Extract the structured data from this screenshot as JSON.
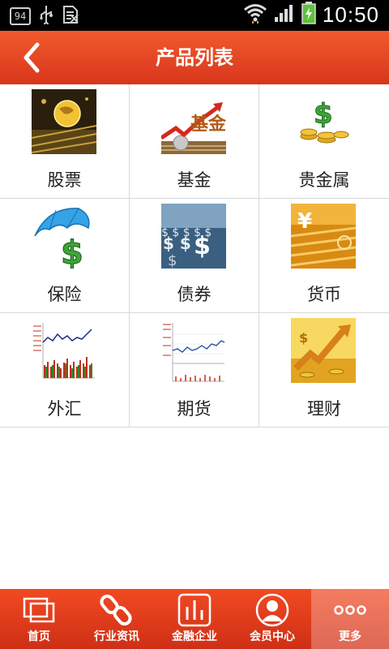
{
  "status_bar": {
    "badge": "94",
    "time": "10:50"
  },
  "header": {
    "title": "产品列表",
    "back_icon": "chevron-left-icon"
  },
  "products": [
    {
      "label": "股票",
      "icon": "globe-gold-icon"
    },
    {
      "label": "基金",
      "icon": "fund-chart-icon"
    },
    {
      "label": "贵金属",
      "icon": "gold-coins-icon"
    },
    {
      "label": "保险",
      "icon": "umbrella-dollar-icon"
    },
    {
      "label": "债券",
      "icon": "dollar-row-icon"
    },
    {
      "label": "货币",
      "icon": "yen-gold-icon"
    },
    {
      "label": "外汇",
      "icon": "forex-chart-icon"
    },
    {
      "label": "期货",
      "icon": "futures-chart-icon"
    },
    {
      "label": "理财",
      "icon": "finance-arrow-icon"
    }
  ],
  "bottom_nav": [
    {
      "label": "首页",
      "icon": "home-pages-icon"
    },
    {
      "label": "行业资讯",
      "icon": "link-chain-icon"
    },
    {
      "label": "金融企业",
      "icon": "bar-chart-icon"
    },
    {
      "label": "会员中心",
      "icon": "user-avatar-icon"
    },
    {
      "label": "更多",
      "icon": "more-dots-icon"
    }
  ],
  "colors": {
    "brand": "#e0401f",
    "brand_dark": "#cf2f16",
    "text": "#222222",
    "divider": "#d9d9d9"
  }
}
